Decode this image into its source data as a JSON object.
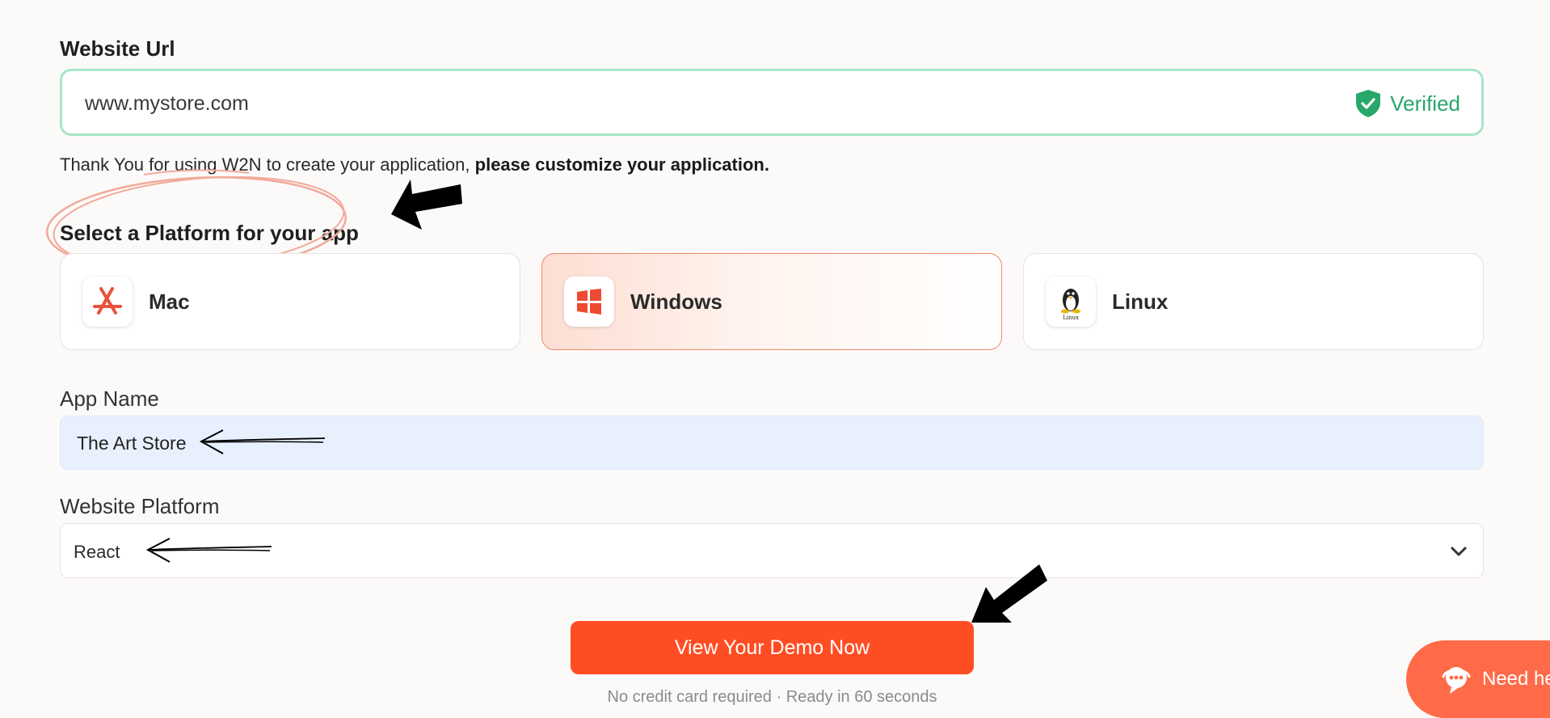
{
  "website_url": {
    "label": "Website Url",
    "value": "www.mystore.com",
    "status": "Verified",
    "status_color": "#27a86a"
  },
  "intro": {
    "text": "Thank You for using W2N to create your application,",
    "bold_text": "please customize your application."
  },
  "platform_section": {
    "title": "Select a Platform for your app",
    "options": [
      {
        "label": "Mac",
        "icon": "app-store-icon",
        "selected": false
      },
      {
        "label": "Windows",
        "icon": "windows-icon",
        "selected": true
      },
      {
        "label": "Linux",
        "icon": "linux-tux-icon",
        "selected": false
      }
    ],
    "linux_icon_caption": "Linux"
  },
  "app_name": {
    "label": "App Name",
    "value": "The Art Store"
  },
  "website_platform": {
    "label": "Website Platform",
    "value": "React"
  },
  "cta": {
    "label": "View Your Demo Now",
    "note": "No credit card required · Ready in 60 seconds",
    "color": "#ff4d23"
  },
  "help_widget": {
    "label": "Need he"
  }
}
